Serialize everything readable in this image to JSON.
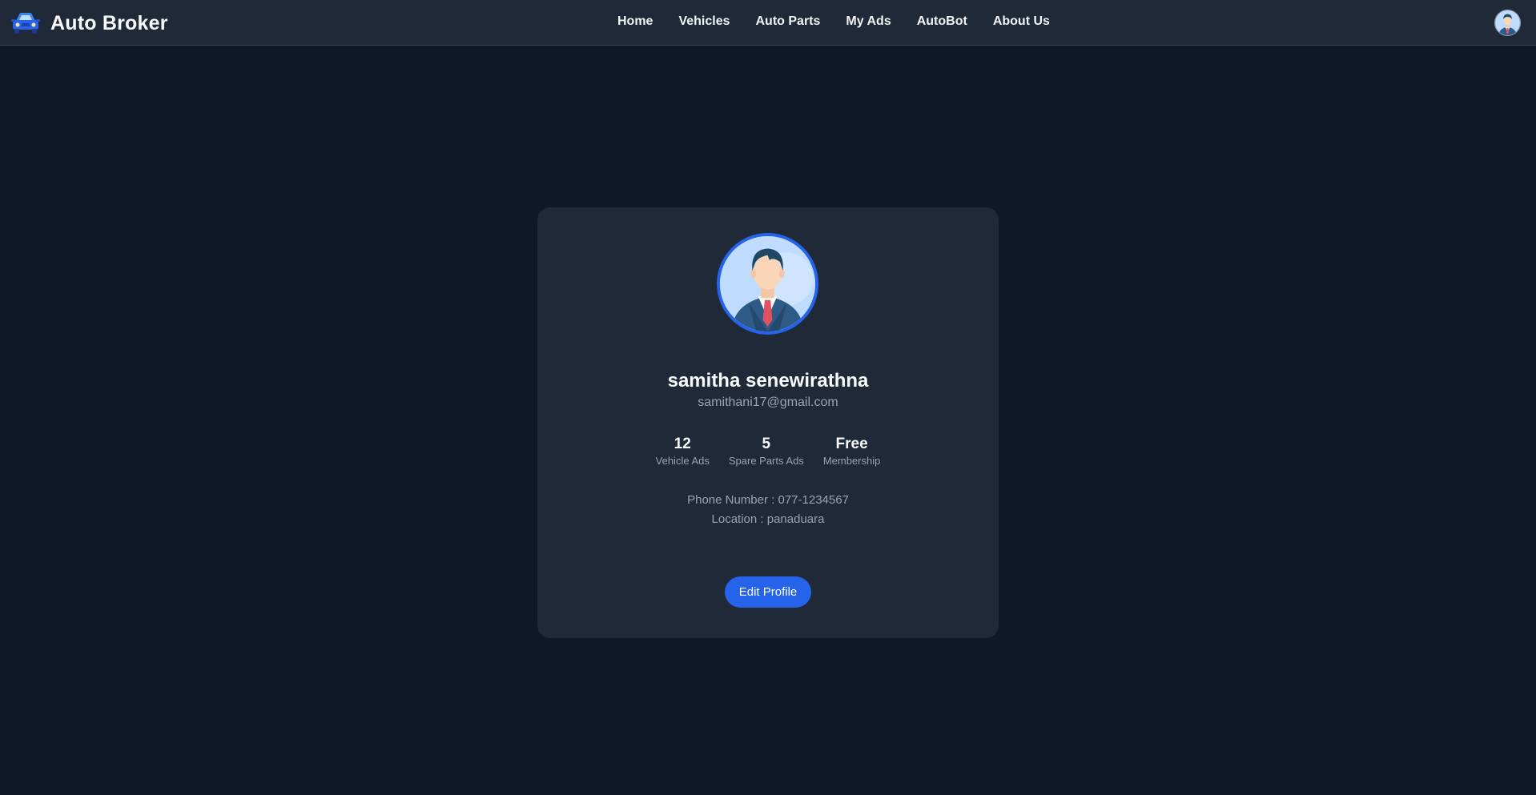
{
  "navbar": {
    "brand_title": "Auto Broker",
    "brand_icon": "car-icon",
    "links": [
      "Home",
      "Vehicles",
      "Auto Parts",
      "My Ads",
      "AutoBot",
      "About Us"
    ],
    "avatar_icon": "user-avatar-icon"
  },
  "profile": {
    "name": "samitha senewirathna",
    "email": "samithani17@gmail.com",
    "stats": [
      {
        "value": "12",
        "label": "Vehicle Ads"
      },
      {
        "value": "5",
        "label": "Spare Parts Ads"
      },
      {
        "value": "Free",
        "label": "Membership"
      }
    ],
    "phone": "Phone Number : 077-1234567",
    "location": "Location : panaduara",
    "edit_label": "Edit Profile"
  },
  "colors": {
    "background": "#111827",
    "navbar": "#1f2937",
    "card": "#1f2937",
    "accent": "#2563eb",
    "muted_text": "#9ca3af"
  }
}
